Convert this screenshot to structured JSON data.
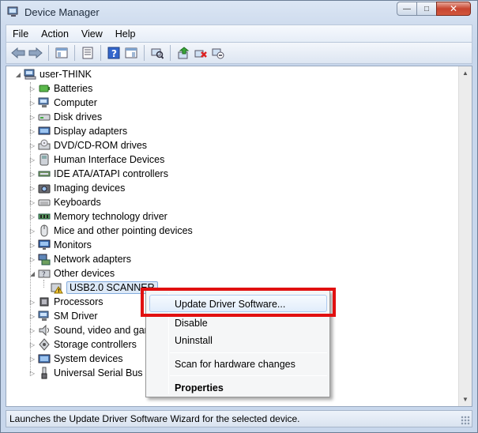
{
  "window": {
    "title": "Device Manager",
    "icon": "device-manager-icon",
    "controls": [
      "minimize-icon",
      "maximize-icon",
      "close-icon"
    ]
  },
  "menubar": {
    "items": [
      "File",
      "Action",
      "View",
      "Help"
    ]
  },
  "toolbar": {
    "buttons": [
      "back-icon",
      "forward-icon",
      "show-hide-console-tree-icon",
      "properties-icon",
      "help-icon",
      "show-action-pane-icon",
      "scan-hardware-icon",
      "update-driver-icon",
      "uninstall-icon",
      "disable-icon"
    ]
  },
  "tree": {
    "root": "user-THINK",
    "items": [
      {
        "label": "Batteries",
        "icon": "battery-icon",
        "expanded": false
      },
      {
        "label": "Computer",
        "icon": "computer-icon",
        "expanded": false
      },
      {
        "label": "Disk drives",
        "icon": "disk-drive-icon",
        "expanded": false
      },
      {
        "label": "Display adapters",
        "icon": "display-adapter-icon",
        "expanded": false
      },
      {
        "label": "DVD/CD-ROM drives",
        "icon": "dvd-drive-icon",
        "expanded": false
      },
      {
        "label": "Human Interface Devices",
        "icon": "hid-icon",
        "expanded": false
      },
      {
        "label": "IDE ATA/ATAPI controllers",
        "icon": "ide-controller-icon",
        "expanded": false
      },
      {
        "label": "Imaging devices",
        "icon": "camera-icon",
        "expanded": false
      },
      {
        "label": "Keyboards",
        "icon": "keyboard-icon",
        "expanded": false
      },
      {
        "label": "Memory technology driver",
        "icon": "memory-icon",
        "expanded": false
      },
      {
        "label": "Mice and other pointing devices",
        "icon": "mouse-icon",
        "expanded": false
      },
      {
        "label": "Monitors",
        "icon": "monitor-icon",
        "expanded": false
      },
      {
        "label": "Network adapters",
        "icon": "network-icon",
        "expanded": false
      },
      {
        "label": "Other devices",
        "icon": "other-devices-icon",
        "expanded": true
      },
      {
        "label": "USB2.0 SCANNER",
        "icon": "warning-device-icon",
        "child": true,
        "selected": true
      },
      {
        "label": "Processors",
        "icon": "processor-icon",
        "expanded": false
      },
      {
        "label": "SM Driver",
        "icon": "sm-driver-icon",
        "expanded": false
      },
      {
        "label": "Sound, video and gan",
        "icon": "sound-icon",
        "expanded": false
      },
      {
        "label": "Storage controllers",
        "icon": "storage-icon",
        "expanded": false
      },
      {
        "label": "System devices",
        "icon": "system-devices-icon",
        "expanded": false
      },
      {
        "label": "Universal Serial Bus co",
        "icon": "usb-icon",
        "expanded": false
      }
    ]
  },
  "context_menu": {
    "update_driver": "Update Driver Software...",
    "disable": "Disable",
    "uninstall": "Uninstall",
    "scan": "Scan for hardware changes",
    "properties": "Properties"
  },
  "statusbar": {
    "text": "Launches the Update Driver Software Wizard for the selected device."
  },
  "colors": {
    "highlight_box": "#e11010",
    "selection": "#dde9f7"
  }
}
